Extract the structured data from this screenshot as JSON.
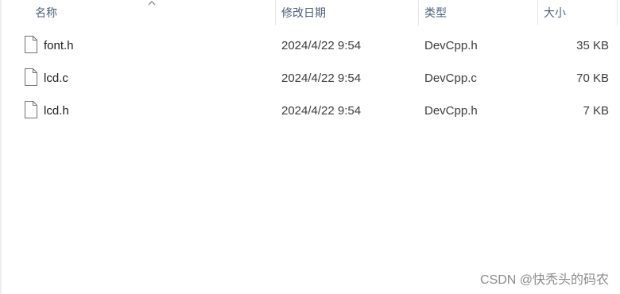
{
  "columns": {
    "name": "名称",
    "date": "修改日期",
    "type": "类型",
    "size": "大小"
  },
  "files": [
    {
      "name": "font.h",
      "date": "2024/4/22 9:54",
      "type": "DevCpp.h",
      "size": "35 KB"
    },
    {
      "name": "lcd.c",
      "date": "2024/4/22 9:54",
      "type": "DevCpp.c",
      "size": "70 KB"
    },
    {
      "name": "lcd.h",
      "date": "2024/4/22 9:54",
      "type": "DevCpp.h",
      "size": "7 KB"
    }
  ],
  "sort": {
    "column": "name",
    "direction": "ascending",
    "icon": "sort-ascending-icon"
  },
  "file_icon": "file-icon",
  "watermark": "CSDN @快秃头的码农",
  "colors": {
    "header_text": "#4c607a",
    "text": "#1a1a1a",
    "separator": "#e5e5e5",
    "watermark": "#8c8c8c"
  }
}
